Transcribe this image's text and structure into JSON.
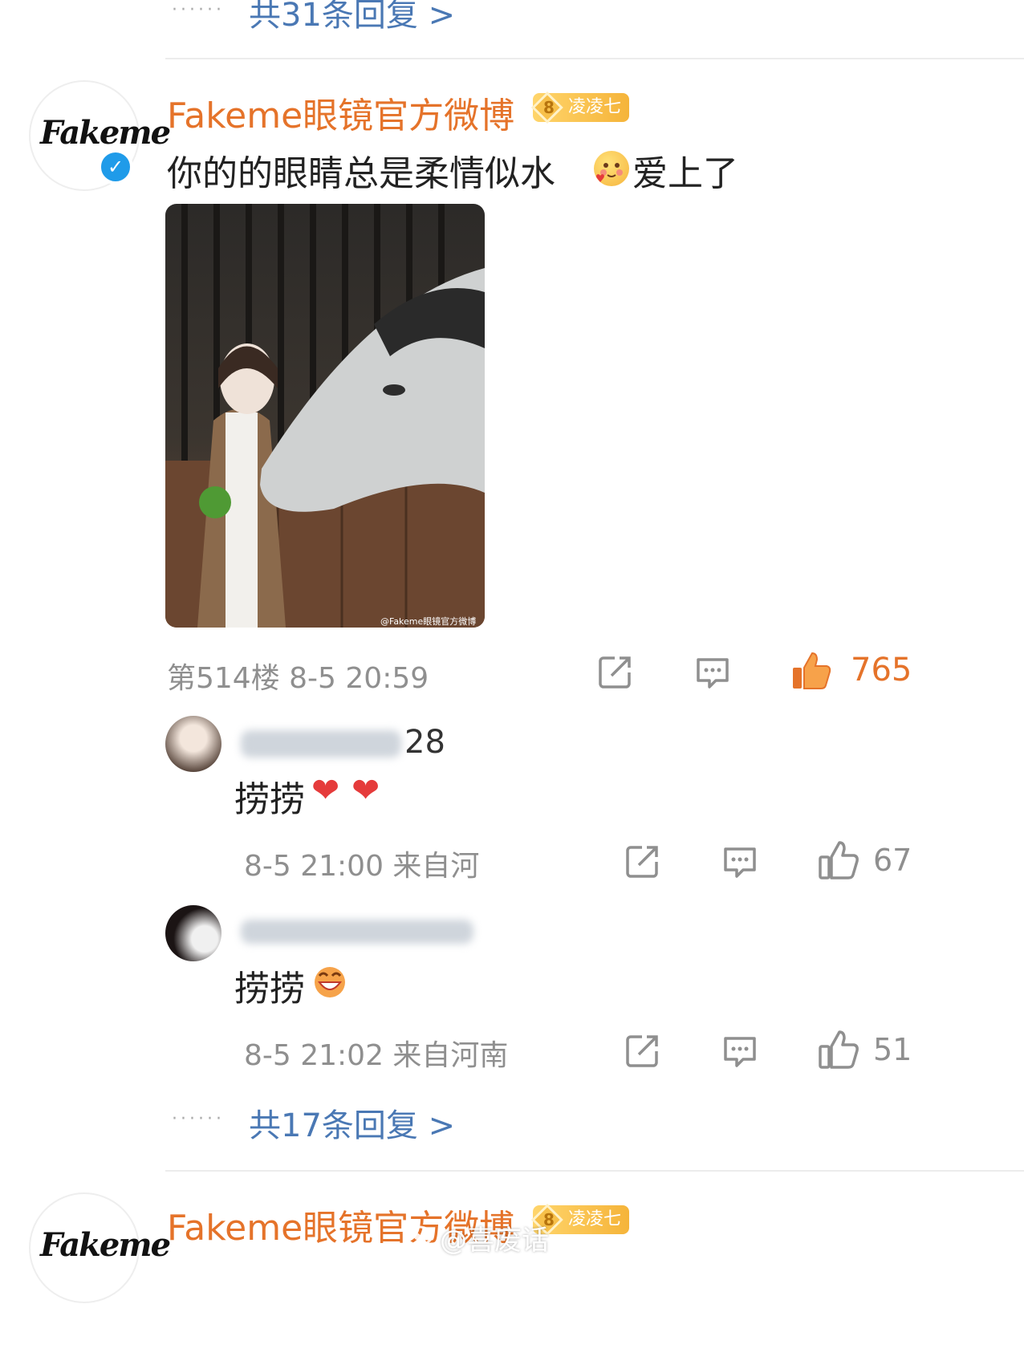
{
  "top_more_replies": {
    "dots": "······",
    "label": "共31条回复 >"
  },
  "comment": {
    "username": "Fakeme眼镜官方微博",
    "avatar_logo": "Fakeme",
    "level_num": "8",
    "level_badge": "凌凌七",
    "text": "你的的眼睛总是柔情似水",
    "text_suffix": "爱上了",
    "emoji_icon": "shy-face-emoji",
    "image_watermark": "@Fakeme眼镜官方微博",
    "floor_time": "第514楼 8-5 20:59",
    "like_count": "765",
    "icons": [
      "share-icon",
      "comment-icon",
      "like-icon"
    ],
    "colors": {
      "username": "#e5732a",
      "liked": "#e5732a",
      "link": "#4a78b4"
    }
  },
  "replies": [
    {
      "name_partial": "28",
      "text": "捞捞",
      "emojis": [
        "heart-icon",
        "heart-icon"
      ],
      "meta": "8-5 21:00 来自河",
      "like_count": "67"
    },
    {
      "name_partial": "",
      "text": "捞捞",
      "emojis": [
        "grin-face-emoji"
      ],
      "meta": "8-5 21:02 来自河南",
      "like_count": "51"
    }
  ],
  "bottom_more_replies": {
    "dots": "······",
    "label": "共17条回复 >"
  },
  "next_comment": {
    "username": "Fakeme眼镜官方微博",
    "avatar_logo": "Fakeme",
    "level_num": "8",
    "level_badge": "凌凌七"
  },
  "watermark": "@喜废话"
}
